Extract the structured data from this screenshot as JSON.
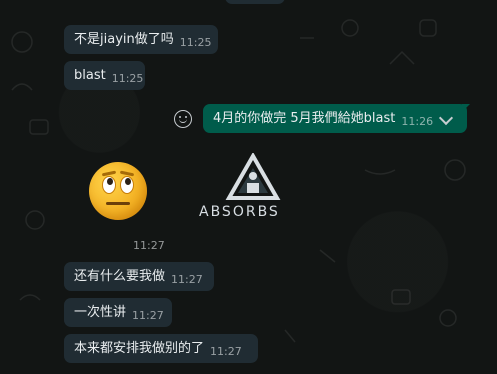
{
  "messages": [
    {
      "text": "不是jiayin做了吗",
      "time": "11:25"
    },
    {
      "text": "blast",
      "time": "11:25"
    },
    {
      "text": "4月的你做完 5月我們給她blast",
      "time": "11:26"
    },
    {
      "text": "11:27",
      "time": "11:27"
    },
    {
      "text": "还有什么要我做",
      "time": "11:27"
    },
    {
      "text": "一次性讲",
      "time": "11:27"
    },
    {
      "text": "本来都安排我做别的了",
      "time": "11:27"
    }
  ],
  "watermark": {
    "text": "ABSORBS"
  },
  "colors": {
    "incoming": "#202c33",
    "outgoing": "#005c4b",
    "background": "#121514"
  }
}
